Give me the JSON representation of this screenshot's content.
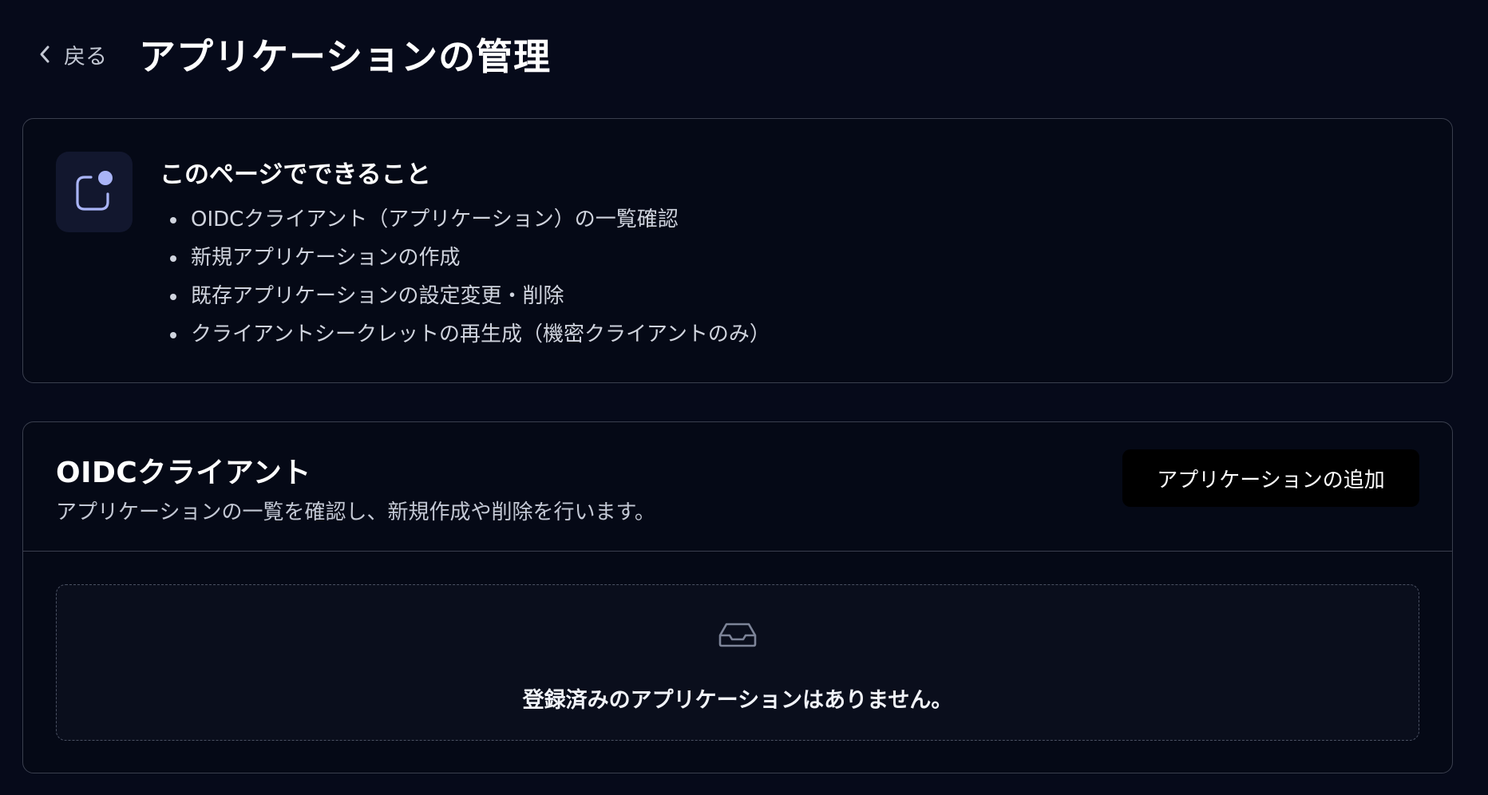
{
  "header": {
    "back_label": "戻る",
    "title": "アプリケーションの管理"
  },
  "info": {
    "icon": "app-notification-icon",
    "title": "このページでできること",
    "items": [
      "OIDCクライアント（アプリケーション）の一覧確認",
      "新規アプリケーションの作成",
      "既存アプリケーションの設定変更・削除",
      "クライアントシークレットの再生成（機密クライアントのみ）"
    ]
  },
  "clients": {
    "title": "OIDCクライアント",
    "description": "アプリケーションの一覧を確認し、新規作成や削除を行います。",
    "add_button_label": "アプリケーションの追加",
    "empty_icon": "inbox-icon",
    "empty_message": "登録済みのアプリケーションはありません。"
  },
  "colors": {
    "background": "#060a1a",
    "card_border": "#3a3f4e",
    "icon_accent": "#a9b4f7",
    "button_bg": "#000000"
  }
}
